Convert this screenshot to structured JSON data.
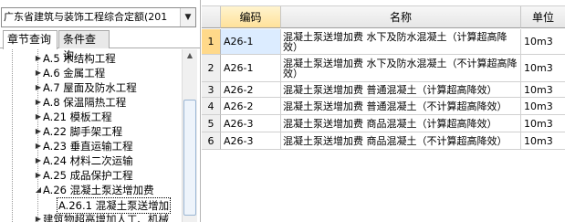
{
  "left_panel": {
    "quota_select_value": "广东省建筑与装饰工程综合定额(201",
    "tabs": {
      "chapter": "章节查询",
      "condition": "条件查询"
    },
    "tree_items": [
      "A.5 木结构工程",
      "A.6 金属工程",
      "A.7 屋面及防水工程",
      "A.8 保温隔热工程",
      "A.21 模板工程",
      "A.22 脚手架工程",
      "A.23 垂直运输工程",
      "A.24 材料二次运输",
      "A.25 成品保护工程",
      "A.26 混凝土泵送增加费",
      "A.26.1 混凝土泵送增加",
      "建筑物超高增加人工、机械"
    ]
  },
  "grid": {
    "columns": {
      "code": "编码",
      "name": "名称",
      "unit": "单位"
    },
    "rows": [
      {
        "num": "1",
        "code": "A26-1",
        "name": "混凝土泵送增加费 水下及防水混凝土（计算超高降效）",
        "unit": "10m3"
      },
      {
        "num": "2",
        "code": "A26-1",
        "name": "混凝土泵送增加费 水下及防水混凝土（不计算超高降效）",
        "unit": "10m3"
      },
      {
        "num": "3",
        "code": "A26-2",
        "name": "混凝土泵送增加费 普通混凝土（计算超高降效）",
        "unit": "10m3"
      },
      {
        "num": "4",
        "code": "A26-2",
        "name": "混凝土泵送增加费 普通混凝土（不计算超高降效）",
        "unit": "10m3"
      },
      {
        "num": "5",
        "code": "A26-3",
        "name": "混凝土泵送增加费 商品混凝土（计算超高降效）",
        "unit": "10m3"
      },
      {
        "num": "6",
        "code": "A26-3",
        "name": "混凝土泵送增加费 商品混凝土（不计算超高降效）",
        "unit": "10m3"
      }
    ]
  }
}
